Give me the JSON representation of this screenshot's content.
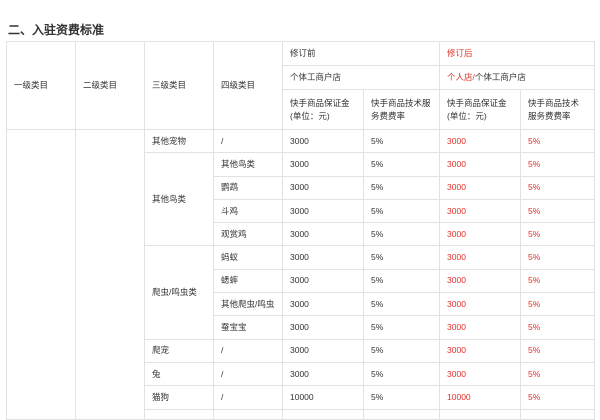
{
  "section_title": "二、入驻资费标准",
  "colors": {
    "revised": "#e0312b",
    "border": "#e2e2e2",
    "text": "#333333"
  },
  "header": {
    "level1": "一级类目",
    "level2": "二级类目",
    "level3": "三级类目",
    "level4": "四级类目",
    "before_label": "修订前",
    "after_label": "修订后",
    "before_store_type": "个体工商户店",
    "after_store_type": "个人店/个体工商户店",
    "deposit_label": "快手商品保证金(单位：元)",
    "fee_label": "快手商品技术服务费费率"
  },
  "rows": [
    {
      "level3": "其他宠物",
      "level4": "/",
      "deposit_before": "3000",
      "fee_before": "5%",
      "deposit_after": "3000",
      "fee_after": "5%"
    },
    {
      "level3": "其他鸟类",
      "level4": "其他鸟类",
      "deposit_before": "3000",
      "fee_before": "5%",
      "deposit_after": "3000",
      "fee_after": "5%"
    },
    {
      "level3": "",
      "level4": "鹦鹉",
      "deposit_before": "3000",
      "fee_before": "5%",
      "deposit_after": "3000",
      "fee_after": "5%"
    },
    {
      "level3": "",
      "level4": "斗鸡",
      "deposit_before": "3000",
      "fee_before": "5%",
      "deposit_after": "3000",
      "fee_after": "5%"
    },
    {
      "level3": "",
      "level4": "观赏鸡",
      "deposit_before": "3000",
      "fee_before": "5%",
      "deposit_after": "3000",
      "fee_after": "5%"
    },
    {
      "level3": "爬虫/鸣虫类",
      "level4": "蚂蚁",
      "deposit_before": "3000",
      "fee_before": "5%",
      "deposit_after": "3000",
      "fee_after": "5%"
    },
    {
      "level3": "",
      "level4": "蟋蟀",
      "deposit_before": "3000",
      "fee_before": "5%",
      "deposit_after": "3000",
      "fee_after": "5%"
    },
    {
      "level3": "",
      "level4": "其他爬虫/鸣虫",
      "deposit_before": "3000",
      "fee_before": "5%",
      "deposit_after": "3000",
      "fee_after": "5%"
    },
    {
      "level3": "",
      "level4": "蚕宝宝",
      "deposit_before": "3000",
      "fee_before": "5%",
      "deposit_after": "3000",
      "fee_after": "5%"
    },
    {
      "level3": "爬宠",
      "level4": "/",
      "deposit_before": "3000",
      "fee_before": "5%",
      "deposit_after": "3000",
      "fee_after": "5%"
    },
    {
      "level3": "兔",
      "level4": "/",
      "deposit_before": "3000",
      "fee_before": "5%",
      "deposit_after": "3000",
      "fee_after": "5%"
    },
    {
      "level3": "猫狗",
      "level4": "/",
      "deposit_before": "10000",
      "fee_before": "5%",
      "deposit_after": "10000",
      "fee_after": "5%"
    }
  ]
}
